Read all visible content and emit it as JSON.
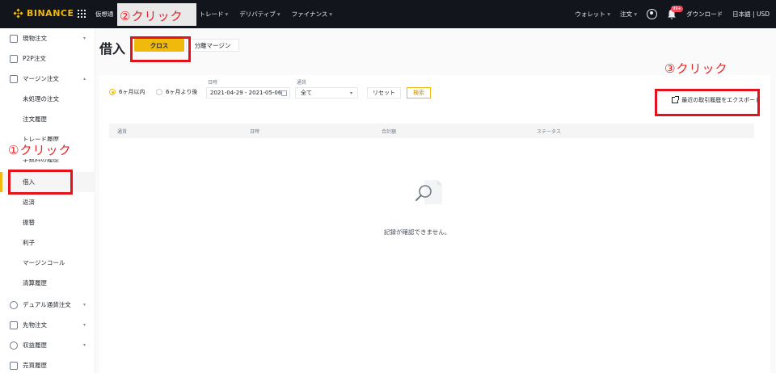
{
  "topbar": {
    "brand": "BINANCE",
    "nav": [
      {
        "label": "仮想通"
      },
      {
        "label": "トレード",
        "caret": "▾"
      },
      {
        "label": "デリバティブ",
        "caret": "▾"
      },
      {
        "label": "ファイナンス",
        "caret": "▾"
      }
    ],
    "right": {
      "wallet": "ウォレット",
      "orders": "注文",
      "caret": "▾",
      "notif_badge": "99+",
      "download": "ダウンロード",
      "language": "日本語",
      "separator": "|",
      "currency": "USD"
    }
  },
  "sidebar": {
    "items": [
      {
        "label": "現物注文",
        "arrow": "▾"
      },
      {
        "label": "P2P注文"
      },
      {
        "label": "マージン注文",
        "arrow": "▴"
      },
      {
        "label": "未処理の注文"
      },
      {
        "label": "注文履歴"
      },
      {
        "label": "トレード履歴"
      },
      {
        "label": "手数料の履歴"
      },
      {
        "label": "借入"
      },
      {
        "label": "返済"
      },
      {
        "label": "振替"
      },
      {
        "label": "利子"
      },
      {
        "label": "マージンコール"
      },
      {
        "label": "清算履歴"
      },
      {
        "label": "デュアル通貨注文",
        "arrow": "▾"
      },
      {
        "label": "先物注文",
        "arrow": "▾"
      },
      {
        "label": "収益履歴",
        "arrow": "▾"
      },
      {
        "label": "売買履歴"
      }
    ]
  },
  "main": {
    "title": "借入",
    "tabs": [
      {
        "label": "クロス",
        "active": true
      },
      {
        "label": "分離マージン",
        "active": false
      }
    ],
    "filters": {
      "range_within": "6ヶ月以内",
      "range_after": "6ヶ月より後",
      "date_label": "日時",
      "date_value": "2021-04-29 - 2021-05-06",
      "coin_label": "通貨",
      "coin_value": "全て",
      "reset": "リセット",
      "search": "検索"
    },
    "export_label": "最近の取引履歴をエクスポート",
    "columns": [
      "通貨",
      "日時",
      "合計額",
      "ステータス"
    ],
    "empty_message": "記録が確認できません。"
  },
  "annotations": {
    "step1": "①クリック",
    "step2": "②クリック",
    "step3": "③クリック"
  },
  "colors": {
    "brand": "#f0b90b",
    "annotation_red": "#e4121b",
    "topbar_bg": "#12161c"
  }
}
